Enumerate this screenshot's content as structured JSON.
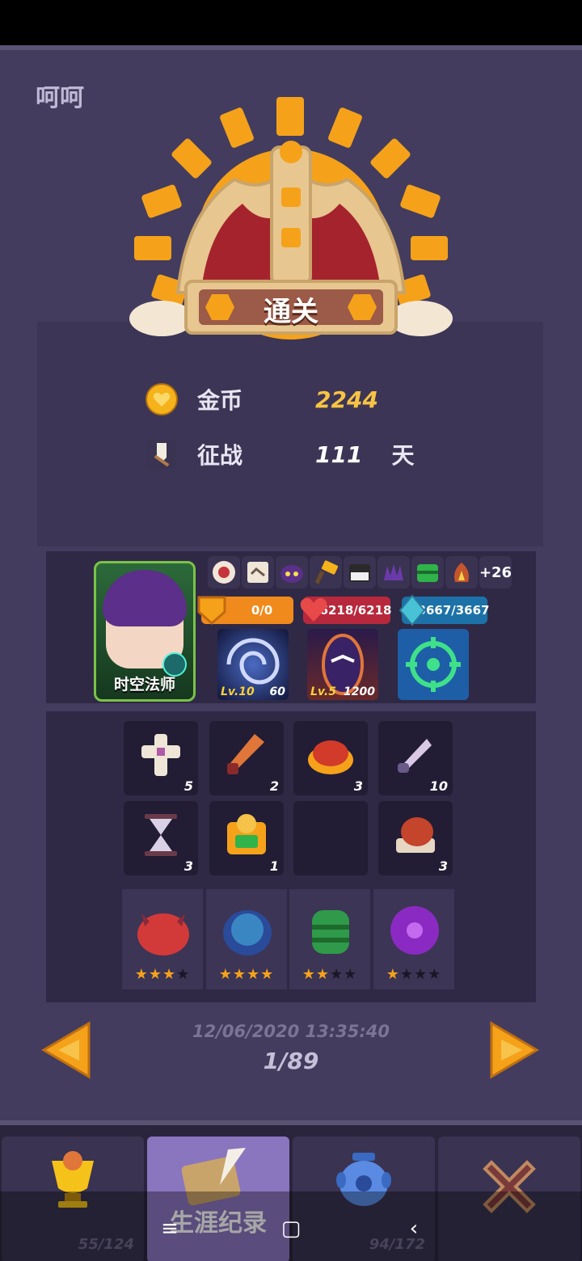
{
  "player": {
    "name": "呵呵"
  },
  "banner": {
    "label": "通关"
  },
  "summary": {
    "gold": {
      "label": "金币",
      "value": "2244"
    },
    "days": {
      "label": "征战",
      "value": "111",
      "unit": "天"
    }
  },
  "hero": {
    "name": "时空法师",
    "relics": [
      "seal-icon",
      "handshake-icon",
      "purple-mask-icon",
      "hammer-icon",
      "piano-icon",
      "claw-icon",
      "green-chest-icon",
      "flame-hood-icon"
    ],
    "relics_more": "+26",
    "shield": "0/0",
    "hp": "6218/6218",
    "mana": "3667/3667",
    "skills": [
      {
        "level": "Lv.10",
        "cost": "60"
      },
      {
        "level": "Lv.5",
        "cost": "1200"
      },
      {
        "level": "",
        "cost": ""
      }
    ]
  },
  "inventory": {
    "items": [
      {
        "icon": "cross-icon",
        "count": "5"
      },
      {
        "icon": "dagger-icon",
        "count": "2"
      },
      {
        "icon": "pie-icon",
        "count": "3"
      },
      {
        "icon": "knife-icon",
        "count": "10"
      },
      {
        "icon": "hourglass-icon",
        "count": "3"
      },
      {
        "icon": "skull-box-icon",
        "count": "1"
      },
      {
        "icon": "",
        "count": ""
      },
      {
        "icon": "meat-icon",
        "count": "3"
      }
    ],
    "pets": [
      {
        "icon": "red-beast-icon",
        "stars": 3
      },
      {
        "icon": "blue-egg-icon",
        "stars": 4
      },
      {
        "icon": "green-cocoon-icon",
        "stars": 2
      },
      {
        "icon": "purple-orb-icon",
        "stars": 1
      }
    ]
  },
  "pager": {
    "date": "12/06/2020 13:35:40",
    "page": "1/89"
  },
  "tabs": [
    {
      "icon": "trophy-icon",
      "count": "55/124",
      "label": ""
    },
    {
      "icon": "scroll-quill-icon",
      "count": "",
      "label": "生涯纪录"
    },
    {
      "icon": "jar-icon",
      "count": "94/172",
      "label": ""
    },
    {
      "icon": "close-icon",
      "count": "",
      "label": ""
    }
  ],
  "colors": {
    "gold_value": "#f7c343",
    "days_value": "#ffffff",
    "accent": "#f5a21a"
  }
}
